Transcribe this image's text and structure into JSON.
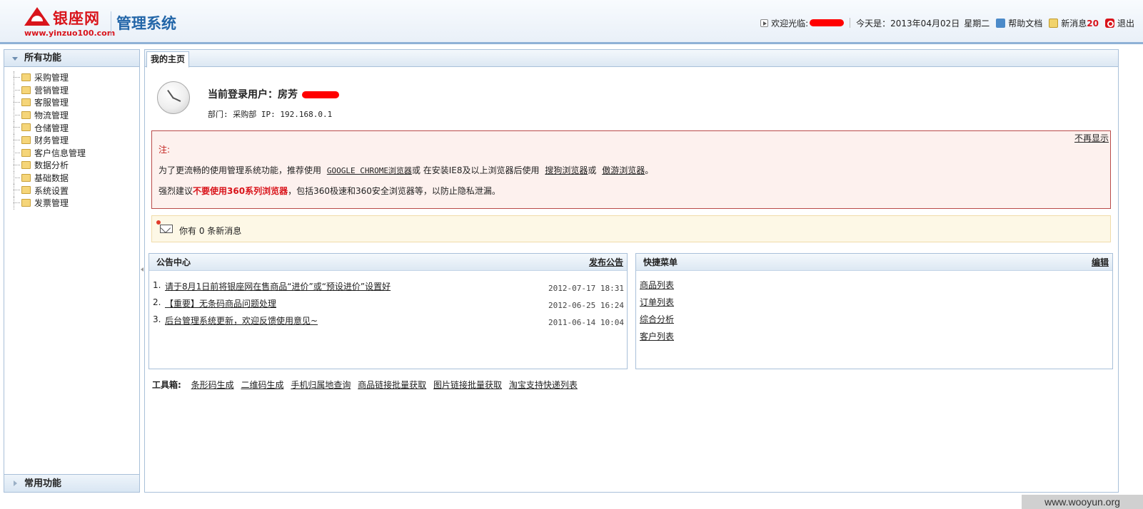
{
  "header": {
    "brand": "银座网",
    "brand_url": "www.yinzuo100.com",
    "system_name": "管理系统",
    "welcome": "欢迎光临:",
    "today_label": "今天是：2013年04月02日",
    "weekday": "星期二",
    "help": "帮助文档",
    "new_msg_label": "新消息",
    "new_msg_count": "20",
    "logout": "退出"
  },
  "sidebar": {
    "title": "所有功能",
    "items": [
      {
        "label": "采购管理"
      },
      {
        "label": "营销管理"
      },
      {
        "label": "客服管理"
      },
      {
        "label": "物流管理"
      },
      {
        "label": "仓储管理"
      },
      {
        "label": "财务管理"
      },
      {
        "label": "客户信息管理"
      },
      {
        "label": "数据分析"
      },
      {
        "label": "基础数据"
      },
      {
        "label": "系统设置"
      },
      {
        "label": "发票管理"
      }
    ],
    "footer": "常用功能"
  },
  "tabs": [
    {
      "label": "我的主页"
    }
  ],
  "user": {
    "current_label": "当前登录用户：房芳",
    "dept": "部门: 采购部 IP: 192.168.0.1"
  },
  "notice": {
    "close": "不再显示",
    "title": "注:",
    "line2_a": "为了更流畅的使用管理系统功能，推荐使用",
    "chrome": "GOOGLE CHROME浏览器",
    "line2_b": "或 在安装IE8及以上浏览器后使用",
    "sogou": "搜狗浏览器",
    "line2_c": "或",
    "maxthon": "傲游浏览器",
    "line2_d": "。",
    "line3_a": "强烈建议",
    "line3_strong": "不要使用360系列浏览器",
    "line3_b": "，包括360极速和360安全浏览器等，以防止隐私泄漏。"
  },
  "messages": {
    "text": "你有 0 条新消息"
  },
  "announcements": {
    "title": "公告中心",
    "publish": "发布公告",
    "items": [
      {
        "no": "1.",
        "title": "请于8月1日前将银座网在售商品“进价”或“预设进价”设置好",
        "date": "2012-07-17 18:31"
      },
      {
        "no": "2.",
        "title": "【重要】无条码商品问题处理",
        "date": "2012-06-25 16:24"
      },
      {
        "no": "3.",
        "title": "后台管理系统更新，欢迎反馈使用意见~",
        "date": "2011-06-14 10:04"
      }
    ]
  },
  "quickmenu": {
    "title": "快捷菜单",
    "edit": "编辑",
    "items": [
      {
        "label": "商品列表"
      },
      {
        "label": "订单列表"
      },
      {
        "label": "综合分析"
      },
      {
        "label": "客户列表"
      }
    ]
  },
  "toolbox": {
    "label": "工具箱:",
    "items": [
      {
        "label": "条形码生成"
      },
      {
        "label": "二维码生成"
      },
      {
        "label": "手机归属地查询"
      },
      {
        "label": "商品链接批量获取"
      },
      {
        "label": "图片链接批量获取"
      },
      {
        "label": "淘宝支持快递列表"
      }
    ]
  },
  "watermark": "www.wooyun.org",
  "colors": {
    "brand_red": "#d9141b",
    "header_blue": "#2366a8",
    "border_blue": "#a9c0d9",
    "notice_border": "#b94a48",
    "notice_bg": "#fdf1ee",
    "message_bg": "#fdf8e6"
  }
}
